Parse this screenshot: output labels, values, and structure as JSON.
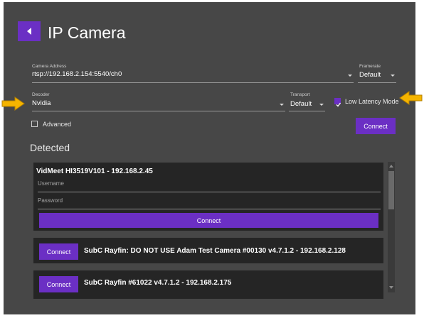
{
  "window": {
    "title": "IP Camera"
  },
  "camera_address": {
    "label": "Camera Address",
    "value": "rtsp://192.168.2.154:5540/ch0"
  },
  "framerate": {
    "label": "Framerate",
    "value": "Default"
  },
  "decoder": {
    "label": "Decoder",
    "value": "Nvidia"
  },
  "transport": {
    "label": "Transport",
    "value": "Default"
  },
  "low_latency": {
    "label": "Low Latency Mode",
    "checked": true
  },
  "advanced": {
    "label": "Advanced",
    "checked": false
  },
  "connect_label": "Connect",
  "detected": {
    "title": "Detected",
    "expanded_device": {
      "name": "VidMeet HI3519V101  -  192.168.2.45",
      "username_placeholder": "Username",
      "password_placeholder": "Password",
      "connect_label": "Connect"
    },
    "devices": [
      {
        "name": "SubC Rayfin: DO NOT USE Adam Test Camera #00130 v4.7.1.2  -  192.168.2.128",
        "connect_label": "Connect"
      },
      {
        "name": "SubC Rayfin #61022 v4.7.1.2  -  192.168.2.175",
        "connect_label": "Connect"
      }
    ]
  },
  "colors": {
    "accent": "#6b2fc4",
    "background": "#474747",
    "card": "#252525",
    "annotation_arrow": "#f5b400"
  },
  "icons": [
    "back-arrow-icon",
    "dropdown-caret-icon",
    "checkbox-icon",
    "annotation-arrow-icon",
    "scroll-up-icon",
    "scroll-down-icon"
  ]
}
